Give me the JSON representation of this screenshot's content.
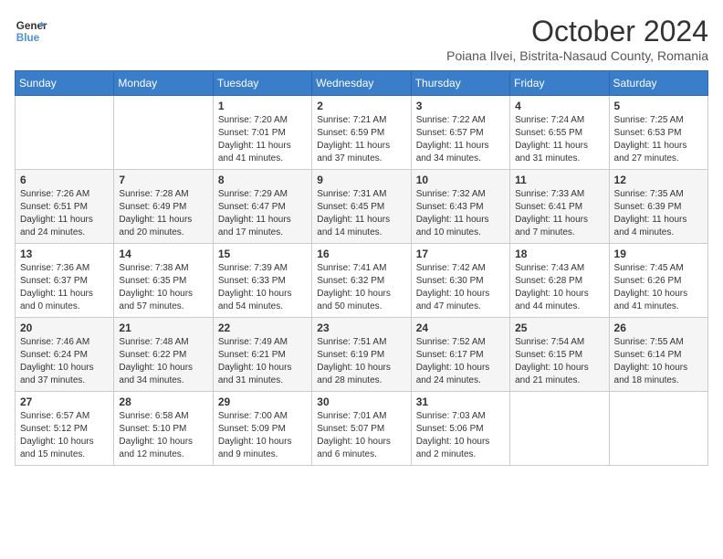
{
  "logo": {
    "line1": "General",
    "line2": "Blue"
  },
  "title": "October 2024",
  "subtitle": "Poiana Ilvei, Bistrita-Nasaud County, Romania",
  "days_of_week": [
    "Sunday",
    "Monday",
    "Tuesday",
    "Wednesday",
    "Thursday",
    "Friday",
    "Saturday"
  ],
  "weeks": [
    [
      {
        "day": "",
        "info": ""
      },
      {
        "day": "",
        "info": ""
      },
      {
        "day": "1",
        "info": "Sunrise: 7:20 AM\nSunset: 7:01 PM\nDaylight: 11 hours and 41 minutes."
      },
      {
        "day": "2",
        "info": "Sunrise: 7:21 AM\nSunset: 6:59 PM\nDaylight: 11 hours and 37 minutes."
      },
      {
        "day": "3",
        "info": "Sunrise: 7:22 AM\nSunset: 6:57 PM\nDaylight: 11 hours and 34 minutes."
      },
      {
        "day": "4",
        "info": "Sunrise: 7:24 AM\nSunset: 6:55 PM\nDaylight: 11 hours and 31 minutes."
      },
      {
        "day": "5",
        "info": "Sunrise: 7:25 AM\nSunset: 6:53 PM\nDaylight: 11 hours and 27 minutes."
      }
    ],
    [
      {
        "day": "6",
        "info": "Sunrise: 7:26 AM\nSunset: 6:51 PM\nDaylight: 11 hours and 24 minutes."
      },
      {
        "day": "7",
        "info": "Sunrise: 7:28 AM\nSunset: 6:49 PM\nDaylight: 11 hours and 20 minutes."
      },
      {
        "day": "8",
        "info": "Sunrise: 7:29 AM\nSunset: 6:47 PM\nDaylight: 11 hours and 17 minutes."
      },
      {
        "day": "9",
        "info": "Sunrise: 7:31 AM\nSunset: 6:45 PM\nDaylight: 11 hours and 14 minutes."
      },
      {
        "day": "10",
        "info": "Sunrise: 7:32 AM\nSunset: 6:43 PM\nDaylight: 11 hours and 10 minutes."
      },
      {
        "day": "11",
        "info": "Sunrise: 7:33 AM\nSunset: 6:41 PM\nDaylight: 11 hours and 7 minutes."
      },
      {
        "day": "12",
        "info": "Sunrise: 7:35 AM\nSunset: 6:39 PM\nDaylight: 11 hours and 4 minutes."
      }
    ],
    [
      {
        "day": "13",
        "info": "Sunrise: 7:36 AM\nSunset: 6:37 PM\nDaylight: 11 hours and 0 minutes."
      },
      {
        "day": "14",
        "info": "Sunrise: 7:38 AM\nSunset: 6:35 PM\nDaylight: 10 hours and 57 minutes."
      },
      {
        "day": "15",
        "info": "Sunrise: 7:39 AM\nSunset: 6:33 PM\nDaylight: 10 hours and 54 minutes."
      },
      {
        "day": "16",
        "info": "Sunrise: 7:41 AM\nSunset: 6:32 PM\nDaylight: 10 hours and 50 minutes."
      },
      {
        "day": "17",
        "info": "Sunrise: 7:42 AM\nSunset: 6:30 PM\nDaylight: 10 hours and 47 minutes."
      },
      {
        "day": "18",
        "info": "Sunrise: 7:43 AM\nSunset: 6:28 PM\nDaylight: 10 hours and 44 minutes."
      },
      {
        "day": "19",
        "info": "Sunrise: 7:45 AM\nSunset: 6:26 PM\nDaylight: 10 hours and 41 minutes."
      }
    ],
    [
      {
        "day": "20",
        "info": "Sunrise: 7:46 AM\nSunset: 6:24 PM\nDaylight: 10 hours and 37 minutes."
      },
      {
        "day": "21",
        "info": "Sunrise: 7:48 AM\nSunset: 6:22 PM\nDaylight: 10 hours and 34 minutes."
      },
      {
        "day": "22",
        "info": "Sunrise: 7:49 AM\nSunset: 6:21 PM\nDaylight: 10 hours and 31 minutes."
      },
      {
        "day": "23",
        "info": "Sunrise: 7:51 AM\nSunset: 6:19 PM\nDaylight: 10 hours and 28 minutes."
      },
      {
        "day": "24",
        "info": "Sunrise: 7:52 AM\nSunset: 6:17 PM\nDaylight: 10 hours and 24 minutes."
      },
      {
        "day": "25",
        "info": "Sunrise: 7:54 AM\nSunset: 6:15 PM\nDaylight: 10 hours and 21 minutes."
      },
      {
        "day": "26",
        "info": "Sunrise: 7:55 AM\nSunset: 6:14 PM\nDaylight: 10 hours and 18 minutes."
      }
    ],
    [
      {
        "day": "27",
        "info": "Sunrise: 6:57 AM\nSunset: 5:12 PM\nDaylight: 10 hours and 15 minutes."
      },
      {
        "day": "28",
        "info": "Sunrise: 6:58 AM\nSunset: 5:10 PM\nDaylight: 10 hours and 12 minutes."
      },
      {
        "day": "29",
        "info": "Sunrise: 7:00 AM\nSunset: 5:09 PM\nDaylight: 10 hours and 9 minutes."
      },
      {
        "day": "30",
        "info": "Sunrise: 7:01 AM\nSunset: 5:07 PM\nDaylight: 10 hours and 6 minutes."
      },
      {
        "day": "31",
        "info": "Sunrise: 7:03 AM\nSunset: 5:06 PM\nDaylight: 10 hours and 2 minutes."
      },
      {
        "day": "",
        "info": ""
      },
      {
        "day": "",
        "info": ""
      }
    ]
  ]
}
